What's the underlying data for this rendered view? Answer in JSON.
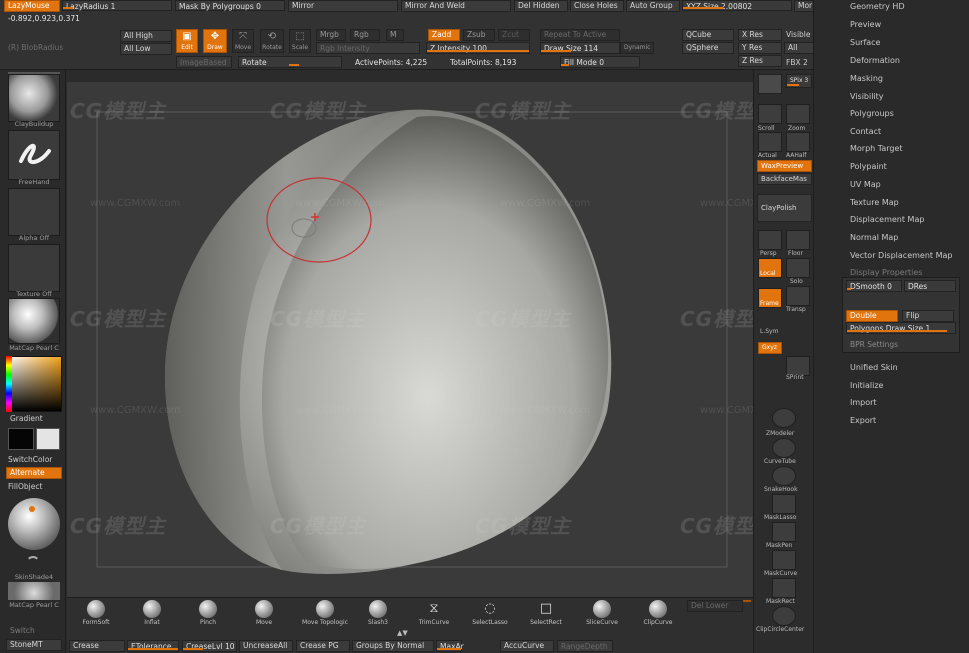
{
  "top_bar": {
    "coords": "-0.892,0.923,0.371",
    "lazymouse_label": "LazyMouse",
    "lazyradius_label": "LazyRadius 1",
    "mask_by_polygroups_label": "Mask By Polygroups 0",
    "mirror_label": "Mirror",
    "mirror_and_weld_label": "Mirror And Weld",
    "del_hidden_label": "Del Hidden",
    "close_holes_label": "Close Holes",
    "auto_group_label": "Auto Group",
    "xyz_size_label": "XYZ Size 2.00802",
    "more_label": "Mor",
    "ghost_label": "(R)   BlobRadius",
    "all_high_label": "All High",
    "all_low_label": "All Low",
    "edit_label": "Edit",
    "draw_label": "Draw",
    "move_label": "Move",
    "rotate_icon_label": "Rotate",
    "scale_label": "Scale",
    "mrgb_label": "Mrgb",
    "rgb_label": "Rgb",
    "m_label": "M",
    "zadd_label": "Zadd",
    "zsub_label": "Zsub",
    "zcut_label": "Zcut",
    "repeat_label": "Repeat To Active",
    "rgb_intensity_label": "Rgb Intensity",
    "z_intensity_label": "Z Intensity 100",
    "draw_size_label": "Draw Size 114",
    "dynamic_label": "Dynamic",
    "qcube_label": "QCube",
    "qsphere_label": "QSphere",
    "x_res_label": "X Res",
    "y_res_label": "Y Res",
    "z_res_label": "Z Res",
    "visible_label": "Visible",
    "all_label": "All",
    "fbx_label": "FBX 2",
    "rotate_slider_label": "Rotate",
    "imagebased_label": "ImageBased",
    "active_points": "ActivePoints: 4,225",
    "total_points": "TotalPoints: 8,193",
    "fill_mode_label": "Fill Mode 0"
  },
  "left_bar": {
    "tools": [
      {
        "label": "ClayBuildup"
      },
      {
        "label": "FreeHand"
      },
      {
        "label": "Alpha Off"
      },
      {
        "label": "Texture Off"
      },
      {
        "label": "MatCap Pearl C"
      }
    ],
    "gradient_label": "Gradient",
    "switchcolor_label": "SwitchColor",
    "alternate_label": "Alternate",
    "fillobject_label": "FillObject",
    "skinshade_label": "SkinShade4",
    "matcap_label": "MatCap Pearl C",
    "switch_label": "Switch",
    "stonemt_label": "StoneMT"
  },
  "right_shelf": {
    "spix_label": "SPix 3",
    "scroll_label": "Scroll",
    "zoom_label": "Zoom",
    "actual_label": "Actual",
    "aahalf_label": "AAHalf",
    "waxpreview_label": "WaxPreview",
    "backfacemask_label": "BackfaceMas",
    "claypolish_label": "ClayPolish",
    "persp_label": "Persp",
    "floor_label": "Floor",
    "local_label": "Local",
    "solo_label": "Solo",
    "frame_label": "Frame",
    "transp_label": "Transp",
    "lsym_label": "L.Sym",
    "gxyz_label": "Gxyz",
    "sprint_label": "SPrint",
    "zmodeler_label": "ZModeler",
    "curvetube_label": "CurveTube",
    "snakehook_label": "SnakeHook",
    "masklasso_label": "MaskLasso",
    "maskpen_label": "MaskPen",
    "maskcurve_label": "MaskCurve",
    "maskrect_label": "MaskRect",
    "clipcirclecenter_label": "ClipCircleCenter"
  },
  "tray": {
    "items": [
      "Geometry HD",
      "Preview",
      "Surface",
      "Deformation",
      "Masking",
      "Visibility",
      "Polygroups",
      "Contact",
      "Morph Target",
      "Polypaint",
      "UV Map",
      "Texture Map",
      "Displacement Map",
      "Normal Map",
      "Vector Displacement Map",
      "Display Properties"
    ],
    "dsmooth_label": "DSmooth 0",
    "dres_label": "DRes",
    "double_label": "Double",
    "flip_label": "Flip",
    "polygons_draw_size_label": "Polygons Draw Size 1",
    "bpr_settings_label": "BPR Settings",
    "bottom_items": [
      "Unified Skin",
      "Initialize",
      "Import",
      "Export"
    ]
  },
  "bottom_bar": {
    "brushes": [
      "FormSoft",
      "Inflat",
      "Pinch",
      "Move",
      "Move Topologic",
      "Slash3",
      "TrimCurve",
      "SelectLasso",
      "SelectRect",
      "SliceCurve",
      "ClipCurve"
    ],
    "del_lower_label": "Del Lower",
    "crease_label": "Crease",
    "etolerance_label": "ETolerance",
    "creaselvl_label": "CreaseLvl 10",
    "uncreaseall_label": "UncreaseAll",
    "crease_pg_label": "Crease PG",
    "groups_by_normal_label": "Groups By Normal",
    "maxangle_label": "MaxAr",
    "accucurve_label": "AccuCurve",
    "rangedepth_label": "RangeDepth"
  },
  "watermark": {
    "brand": "CG模型主",
    "url": "www.CGMXW.com"
  },
  "colors": {
    "accent": "#e2740e",
    "panel": "#2b2b2b",
    "viewport": "#3a3a3a",
    "brush_ring": "#c43232"
  }
}
